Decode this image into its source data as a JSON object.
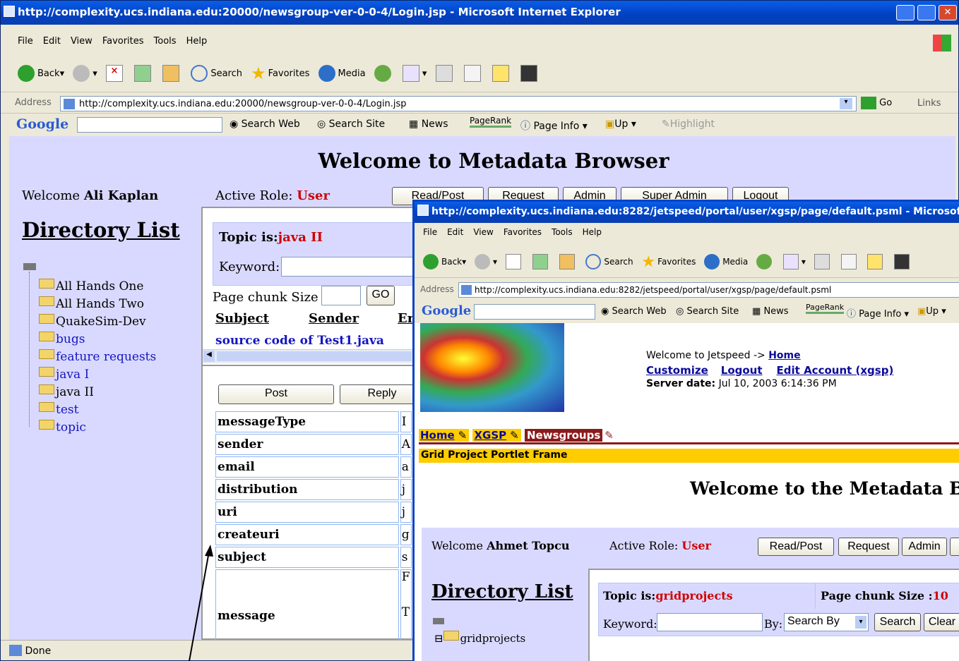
{
  "main_window": {
    "title": "http://complexity.ucs.indiana.edu:20000/newsgroup-ver-0-0-4/Login.jsp - Microsoft Internet Explorer",
    "menu": [
      "File",
      "Edit",
      "View",
      "Favorites",
      "Tools",
      "Help"
    ],
    "toolbar": {
      "back": "Back",
      "search": "Search",
      "favorites": "Favorites",
      "media": "Media"
    },
    "address_label": "Address",
    "address_value": "http://complexity.ucs.indiana.edu:20000/newsgroup-ver-0-0-4/Login.jsp",
    "go": "Go",
    "links": "Links",
    "google_bar": {
      "logo": "Google",
      "search_web": "Search Web",
      "search_site": "Search Site",
      "news": "News",
      "pagerank": "PageRank",
      "page_info": "Page Info",
      "up": "Up",
      "highlight": "Highlight"
    },
    "status": "Done"
  },
  "main_page": {
    "heading": "Welcome to Metadata Browser",
    "welcome_prefix": "Welcome",
    "user": "Ali Kaplan",
    "active_role_label": "Active Role:",
    "active_role": "User",
    "tabs": [
      "Read/Post",
      "Request",
      "Admin",
      "Super Admin",
      "Logout"
    ],
    "directory_title": "Directory List",
    "tree": [
      {
        "label": "All Hands One",
        "link": false
      },
      {
        "label": "All Hands Two",
        "link": false
      },
      {
        "label": "QuakeSim-Dev",
        "link": false
      },
      {
        "label": "bugs",
        "link": true
      },
      {
        "label": "feature requests",
        "link": true
      },
      {
        "label": "java I",
        "link": true
      },
      {
        "label": "java II",
        "link": false
      },
      {
        "label": "test",
        "link": true
      },
      {
        "label": "topic",
        "link": true
      }
    ],
    "topic_label": "Topic is:",
    "topic": "java II",
    "keyword_label": "Keyword:",
    "page_chunk_label": "Page chunk Size :",
    "go_button": "GO",
    "columns": [
      "Subject",
      "Sender",
      "Er"
    ],
    "message_link": "source code of Test1.java",
    "post_button": "Post",
    "reply_button": "Reply",
    "fields": [
      {
        "name": "messageType",
        "val": "I"
      },
      {
        "name": "sender",
        "val": "A"
      },
      {
        "name": "email",
        "val": "a"
      },
      {
        "name": "distribution",
        "val": "j"
      },
      {
        "name": "uri",
        "val": "j"
      },
      {
        "name": "createuri",
        "val": "g"
      },
      {
        "name": "subject",
        "val": "s"
      }
    ],
    "message_label": "message",
    "message_vals": [
      "F",
      "T"
    ]
  },
  "popup_window": {
    "title": "http://complexity.ucs.indiana.edu:8282/jetspeed/portal/user/xgsp/page/default.psml - Microsoft Internet Explorer",
    "menu": [
      "File",
      "Edit",
      "View",
      "Favorites",
      "Tools",
      "Help"
    ],
    "toolbar": {
      "back": "Back",
      "search": "Search",
      "favorites": "Favorites",
      "media": "Media"
    },
    "address_label": "Address",
    "address_value": "http://complexity.ucs.indiana.edu:8282/jetspeed/portal/user/xgsp/page/default.psml",
    "google_bar": {
      "logo": "Google",
      "search_web": "Search Web",
      "search_site": "Search Site",
      "news": "News",
      "pagerank": "PageRank",
      "page_info": "Page Info",
      "up": "Up"
    }
  },
  "portal": {
    "welcome_text": "Welcome to Jetspeed ->",
    "home_link": "Home",
    "customize": "Customize",
    "logout": "Logout",
    "edit_account": "Edit Account (xgsp)",
    "server_date_label": "Server date:",
    "server_date": "Jul 10, 2003 6:14:36 PM",
    "tabs": [
      "Home",
      "XGSP",
      "Newsgroups"
    ],
    "frame_title": "Grid Project Portlet Frame",
    "heading": "Welcome to the Metadata Brows",
    "welcome_prefix": "Welcome",
    "user": "Ahmet Topcu",
    "active_role_label": "Active Role:",
    "active_role": "User",
    "buttons": [
      "Read/Post",
      "Request",
      "Admin"
    ],
    "directory_title": "Directory List",
    "topic_label": "Topic is:",
    "topic": "gridprojects",
    "page_chunk_label": "Page chunk Size :",
    "page_chunk": "10",
    "keyword_label": "Keyword:",
    "by_label": "By:",
    "search_by": "Search By",
    "search_button": "Search",
    "clear_button": "Clear",
    "tree_root": "gridprojects"
  },
  "colors": {
    "title_blue": "#0a5ee8",
    "page_bg": "#d9d9ff",
    "role_red": "#d00000",
    "tab_yellow": "#ffcc00",
    "tab_active": "#8b1a1a"
  }
}
